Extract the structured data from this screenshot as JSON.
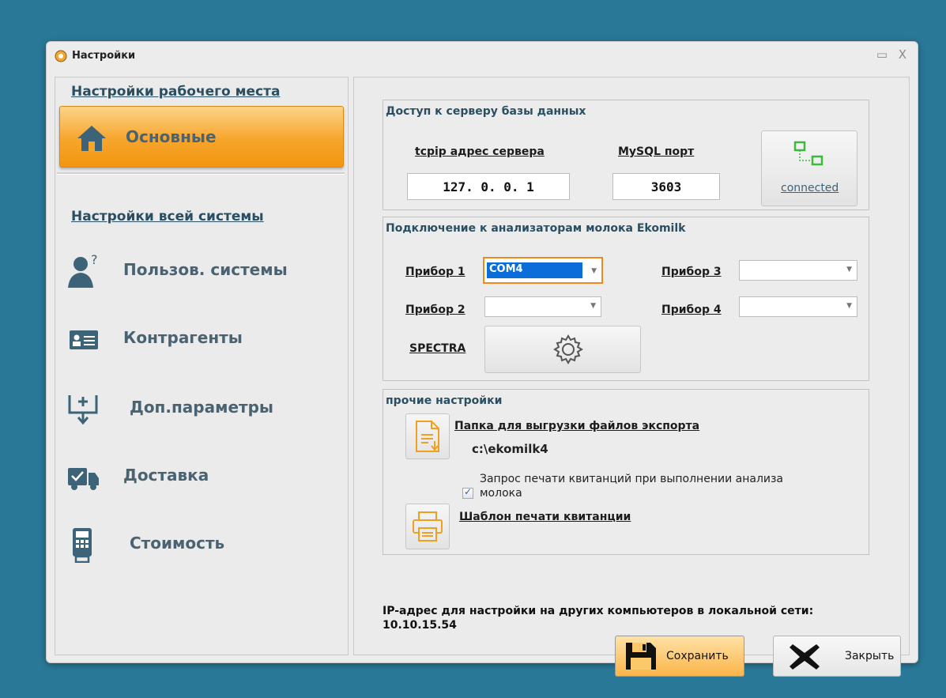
{
  "window": {
    "title": "Настройки"
  },
  "sidebar": {
    "workplace_header": "Настройки рабочего места",
    "active_item": "Основные",
    "system_header": "Настройки всей системы",
    "items": [
      {
        "label": "Пользов. системы",
        "icon": "user-question-icon"
      },
      {
        "label": "Контрагенты",
        "icon": "contact-card-icon"
      },
      {
        "label": "Доп.параметры",
        "icon": "add-download-icon"
      },
      {
        "label": "Доставка",
        "icon": "delivery-truck-icon"
      },
      {
        "label": "Стоимость",
        "icon": "payment-terminal-icon"
      }
    ]
  },
  "db": {
    "title": "Доступ к серверу базы данных",
    "ip_label": "tcpip адрес сервера",
    "ip_value": "127. 0. 0. 1",
    "port_label": "MySQL порт",
    "port_value": "3603",
    "status": "connected"
  },
  "analyzers": {
    "title": "Подключение к анализаторам молока Ekomilk",
    "device1_label": "Прибор 1",
    "device1_value": "COM4",
    "device2_label": "Прибор 2",
    "device3_label": "Прибор 3",
    "device4_label": "Прибор 4",
    "spectra_label": "SPECTRA",
    "spectra_checked": true
  },
  "other": {
    "title": "прочие настройки",
    "export_label": "Папка для выгрузки файлов экспорта",
    "export_path": "c:\\ekomilk4",
    "print_request": "Запрос печати квитанций при выполнении анализа молока",
    "print_template": "Шаблон печати квитанции"
  },
  "footer": {
    "ip_info": "IP-адрес для настройки на других компьютеров в локальной сети: 10.10.15.54",
    "save_label": "Сохранить",
    "close_label": "Закрыть"
  },
  "colors": {
    "background": "#2a7897",
    "accent": "#f7a52b",
    "selection": "#0a6dd8"
  }
}
